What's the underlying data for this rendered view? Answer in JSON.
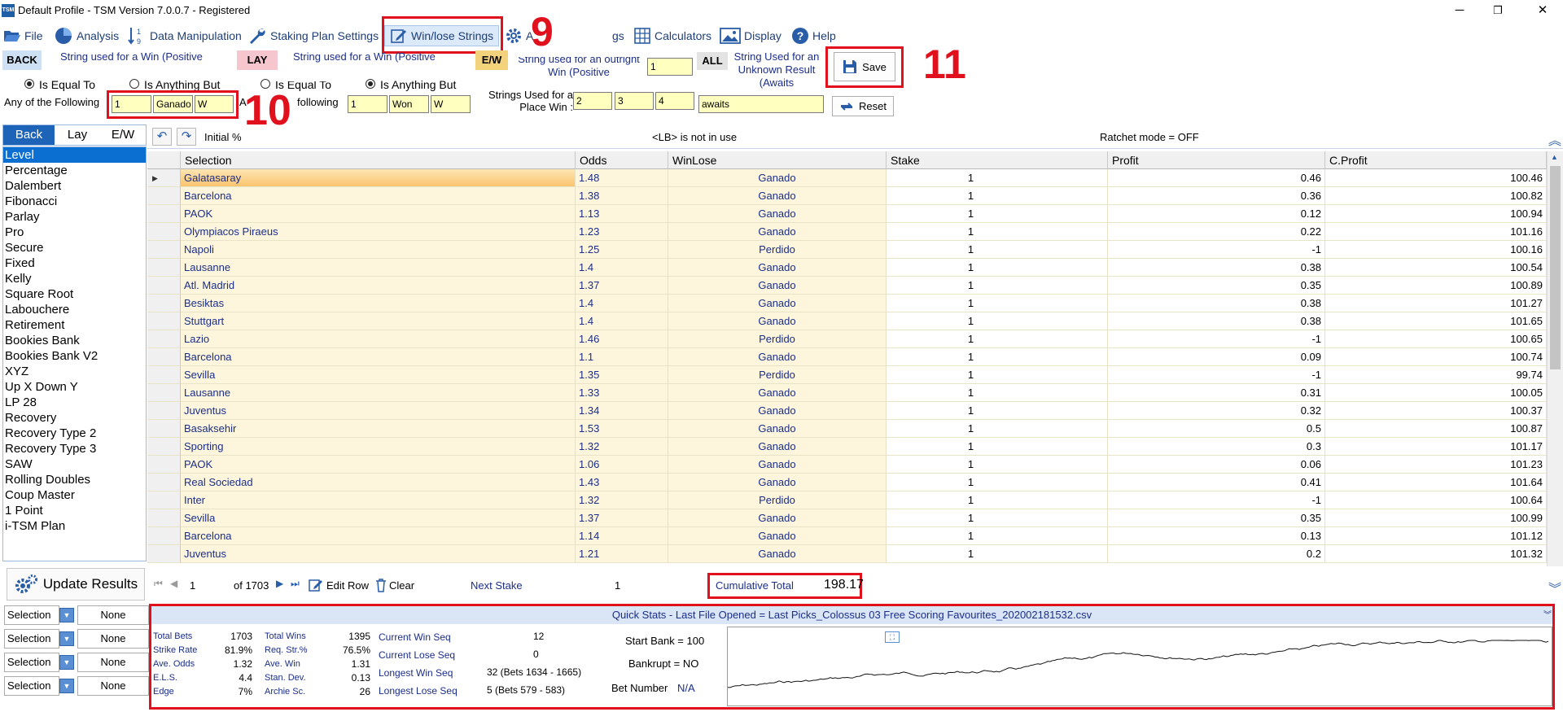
{
  "window": {
    "title": "Default Profile  - TSM Version 7.0.0.7 - Registered",
    "logo_text": "TSM",
    "minimize": "─",
    "restore": "❐",
    "close": "✕"
  },
  "menu": {
    "file": "File",
    "analysis": "Analysis",
    "data_manipulation": "Data Manipulation",
    "staking_plan_settings": "Staking Plan Settings",
    "win_lose_strings": "Win/lose Strings",
    "a_partial": "A",
    "gs_partial": "gs",
    "calculators": "Calculators",
    "display": "Display",
    "help": "Help"
  },
  "callouts": {
    "n9": "9",
    "n10": "10",
    "n11": "11"
  },
  "strings_panel": {
    "back_tag": "BACK",
    "back_label": "String used for a Win (Positive",
    "is_equal_to": "Is Equal To",
    "is_anything_but": "Is Anything But",
    "any_of_following": "Any of the Following",
    "back_values": [
      "1",
      "Ganado",
      "W"
    ],
    "lay_tag": "LAY",
    "lay_label": "String used for a Win (Positive",
    "lay_is_equal_to": "Is Equal To",
    "lay_is_anything_but": "Is Anything But",
    "lay_following": "following",
    "lay_a": "A",
    "lay_values": [
      "1",
      "Won",
      "W"
    ],
    "ew_tag": "E/W",
    "outright_label": "String used for an outright Win (Positive",
    "outright_value": "1",
    "place_label": "Strings Used for a Place Win :",
    "place_values": [
      "2",
      "3",
      "4"
    ],
    "all_tag": "ALL",
    "unknown_label": "String Used for an Unknown Result  (Awaits",
    "unknown_value": "awaits",
    "save": "Save",
    "reset": "Reset"
  },
  "plans": {
    "tabs": [
      "Back",
      "Lay",
      "E/W"
    ],
    "items": [
      "Level",
      "Percentage",
      "Dalembert",
      "Fibonacci",
      "Parlay",
      "Pro",
      "Secure",
      "Fixed",
      "Kelly",
      "Square Root",
      "Labouchere",
      "Retirement",
      "Bookies Bank",
      "Bookies Bank V2",
      "XYZ",
      "Up X Down Y",
      "LP 28",
      "Recovery",
      "Recovery Type 2",
      "Recovery Type 3",
      "SAW",
      "Rolling Doubles",
      "Coup Master",
      "1 Point",
      "i-TSM Plan"
    ],
    "selected": "Level",
    "update_results": "Update Results"
  },
  "filters": [
    {
      "field": "Selection",
      "value": "None"
    },
    {
      "field": "Selection",
      "value": "None"
    },
    {
      "field": "Selection",
      "value": "None"
    },
    {
      "field": "Selection",
      "value": "None"
    }
  ],
  "grid_toolbar": {
    "initial": "Initial %",
    "lb_note": "<LB> is not in use",
    "ratchet": "Ratchet mode = OFF"
  },
  "grid": {
    "columns": [
      "Selection",
      "Odds",
      "WinLose",
      "Stake",
      "Profit",
      "C.Profit"
    ],
    "rows": [
      [
        "Galatasaray",
        "1.48",
        "Ganado",
        "1",
        "0.46",
        "100.46"
      ],
      [
        "Barcelona",
        "1.38",
        "Ganado",
        "1",
        "0.36",
        "100.82"
      ],
      [
        "PAOK",
        "1.13",
        "Ganado",
        "1",
        "0.12",
        "100.94"
      ],
      [
        "Olympiacos Piraeus",
        "1.23",
        "Ganado",
        "1",
        "0.22",
        "101.16"
      ],
      [
        "Napoli",
        "1.25",
        "Perdido",
        "1",
        "-1",
        "100.16"
      ],
      [
        "Lausanne",
        "1.4",
        "Ganado",
        "1",
        "0.38",
        "100.54"
      ],
      [
        "Atl. Madrid",
        "1.37",
        "Ganado",
        "1",
        "0.35",
        "100.89"
      ],
      [
        "Besiktas",
        "1.4",
        "Ganado",
        "1",
        "0.38",
        "101.27"
      ],
      [
        "Stuttgart",
        "1.4",
        "Ganado",
        "1",
        "0.38",
        "101.65"
      ],
      [
        "Lazio",
        "1.46",
        "Perdido",
        "1",
        "-1",
        "100.65"
      ],
      [
        "Barcelona",
        "1.1",
        "Ganado",
        "1",
        "0.09",
        "100.74"
      ],
      [
        "Sevilla",
        "1.35",
        "Perdido",
        "1",
        "-1",
        "99.74"
      ],
      [
        "Lausanne",
        "1.33",
        "Ganado",
        "1",
        "0.31",
        "100.05"
      ],
      [
        "Juventus",
        "1.34",
        "Ganado",
        "1",
        "0.32",
        "100.37"
      ],
      [
        "Basaksehir",
        "1.53",
        "Ganado",
        "1",
        "0.5",
        "100.87"
      ],
      [
        "Sporting",
        "1.32",
        "Ganado",
        "1",
        "0.3",
        "101.17"
      ],
      [
        "PAOK",
        "1.06",
        "Ganado",
        "1",
        "0.06",
        "101.23"
      ],
      [
        "Real Sociedad",
        "1.43",
        "Ganado",
        "1",
        "0.41",
        "101.64"
      ],
      [
        "Inter",
        "1.32",
        "Perdido",
        "1",
        "-1",
        "100.64"
      ],
      [
        "Sevilla",
        "1.37",
        "Ganado",
        "1",
        "0.35",
        "100.99"
      ],
      [
        "Barcelona",
        "1.14",
        "Ganado",
        "1",
        "0.13",
        "101.12"
      ],
      [
        "Juventus",
        "1.21",
        "Ganado",
        "1",
        "0.2",
        "101.32"
      ]
    ]
  },
  "navigator": {
    "position": "1",
    "of_total": "of 1703",
    "edit_row": "Edit Row",
    "clear": "Clear",
    "next_stake_label": "Next Stake",
    "next_stake_value": "1",
    "cumulative_label": "Cumulative Total",
    "cumulative_value": "198.17"
  },
  "quick_stats": {
    "header": "Quick Stats - Last File Opened = Last Picks_Colossus 03 Free Scoring Favourites_202002181532.csv",
    "col1": [
      {
        "label": "Total Bets",
        "value": "1703"
      },
      {
        "label": "Strike Rate",
        "value": "81.9%"
      },
      {
        "label": "Ave. Odds",
        "value": "1.32"
      },
      {
        "label": "E.L.S.",
        "value": "4.4"
      },
      {
        "label": "Edge",
        "value": "7%"
      }
    ],
    "col2": [
      {
        "label": "Total Wins",
        "value": "1395"
      },
      {
        "label": "Req. Str.%",
        "value": "76.5%"
      },
      {
        "label": "Ave. Win",
        "value": "1.31"
      },
      {
        "label": "Stan. Dev.",
        "value": "0.13"
      },
      {
        "label": "Archie Sc.",
        "value": "26"
      }
    ],
    "col3": [
      {
        "label": "Current Win Seq",
        "value": "12"
      },
      {
        "label": "Current Lose Seq",
        "value": "0"
      },
      {
        "label": "Longest Win Seq",
        "value": "32  (Bets 1634 - 1665)"
      },
      {
        "label": "Longest Lose Seq",
        "value": "5  (Bets 579 - 583)"
      }
    ],
    "start_bank": "Start Bank = 100",
    "bankrupt": "Bankrupt = NO",
    "bet_number_label": "Bet Number",
    "bet_number_value": "N/A"
  },
  "colors": {
    "accent_red": "#e0101c",
    "selected_blue": "#0b6ed1",
    "label_blue": "#1b2e8a",
    "row_yellow": "#fdf6dc"
  }
}
